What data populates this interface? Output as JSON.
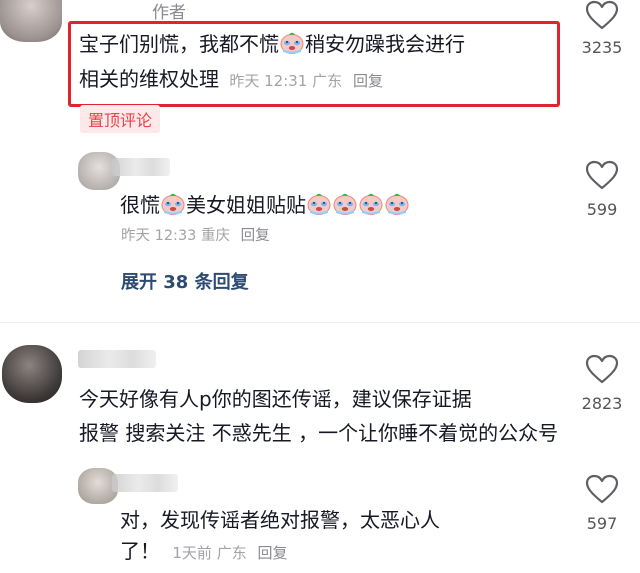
{
  "comments": [
    {
      "author_badge": "作者",
      "text_line1": "宝子们别慌，我都不慌",
      "text_line1b": "稍安勿躁我会进行",
      "text_line2": "相关的维权处理",
      "time": "昨天 12:31",
      "location": "广东",
      "reply_label": "回复",
      "pinned_label": "置顶评论",
      "likes": "3235"
    },
    {
      "text_a": "很慌",
      "text_b": "美女姐姐贴贴",
      "time": "昨天 12:33",
      "location": "重庆",
      "reply_label": "回复",
      "likes": "599",
      "expand_label": "展开 38 条回复"
    },
    {
      "text_line1": "今天好像有人p你的图还传谣，建议保存证据",
      "text_line2": "报警 搜索关注 不惑先生 ，一个让你睡不着觉的公众号",
      "likes": "2823"
    },
    {
      "text_line1": "对，发现传谣者绝对报警，太恶心人",
      "text_line2": "了！",
      "time": "1天前",
      "location": "广东",
      "reply_label": "回复",
      "likes": "597"
    }
  ],
  "colors": {
    "highlight_border": "#e0242f",
    "pinned_text": "#e8424a",
    "pinned_bg": "#fde9ea",
    "expand_text": "#2d4a73"
  },
  "icons": [
    "heart-outline-icon",
    "crying-emoji-icon"
  ]
}
